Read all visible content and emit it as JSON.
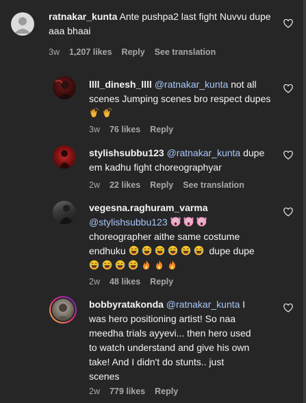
{
  "comments": [
    {
      "username": "ratnakar_kunta",
      "mention": "",
      "text": "Ante pushpa2 last fight Nuvvu dupe aaa bhaai",
      "time": "3w",
      "likes": "1,207 likes",
      "reply": "Reply",
      "translate": "See translation"
    },
    {
      "username": "llll_dinesh_llll",
      "mention": "@ratnakar_kunta",
      "text": "not all scenes Jumping scenes bro respect dupes",
      "time": "3w",
      "likes": "76 likes",
      "reply": "Reply"
    },
    {
      "username": "stylishsubbu123",
      "mention": "@ratnakar_kunta",
      "text": "dupe em kadhu fight choreographyar",
      "time": "2w",
      "likes": "22 likes",
      "reply": "Reply",
      "translate": "See translation"
    },
    {
      "username": "vegesna.raghuram_varma",
      "mention": "@stylishsubbu123",
      "text_line2": "choreographer aithe same costume",
      "text_line3a": "endhuku",
      "text_line3b": "dupe dupe",
      "time": "2w",
      "likes": "48 likes",
      "reply": "Reply"
    },
    {
      "username": "bobbyratakonda",
      "mention": "@ratnakar_kunta",
      "text_tail1": "I",
      "text_lines": [
        "was hero positioning artist! So naa",
        "meedha trials ayyevi... then hero used",
        "to watch understand and give his own",
        "take! And I didn't do stunts.. just",
        "scenes"
      ],
      "time": "2w",
      "likes": "779 likes",
      "reply": "Reply"
    }
  ],
  "icons": {
    "like": "heart-outline-icon",
    "clap": "clapping-hands-emoji",
    "laugh": "tears-of-joy-emoji",
    "fire": "fire-emoji",
    "shock": "screaming-face-emoji"
  },
  "colors": {
    "background": "#262626",
    "text": "#f5f5f5",
    "muted": "#a8a8a8",
    "mention": "#a8c7fa"
  }
}
